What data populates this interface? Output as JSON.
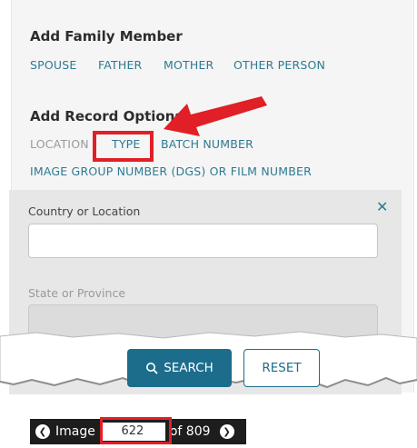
{
  "add_family_member": {
    "title": "Add Family Member",
    "links": [
      "SPOUSE",
      "FATHER",
      "MOTHER",
      "OTHER PERSON"
    ]
  },
  "add_record_options": {
    "title": "Add Record Options",
    "links": [
      "LOCATION",
      "TYPE",
      "BATCH NUMBER",
      "IMAGE GROUP NUMBER (DGS) OR FILM NUMBER"
    ]
  },
  "location_fields": {
    "country_label": "Country or Location",
    "country_value": "",
    "state_label": "State or Province",
    "state_value": "",
    "close_symbol": "✕"
  },
  "buttons": {
    "search": "SEARCH",
    "reset": "RESET"
  },
  "image_nav": {
    "image_label": "Image",
    "current": "622",
    "of_total": "of 809"
  },
  "colors": {
    "link": "#2e7a92",
    "primary": "#1c6d8c",
    "highlight": "#e01f26"
  }
}
